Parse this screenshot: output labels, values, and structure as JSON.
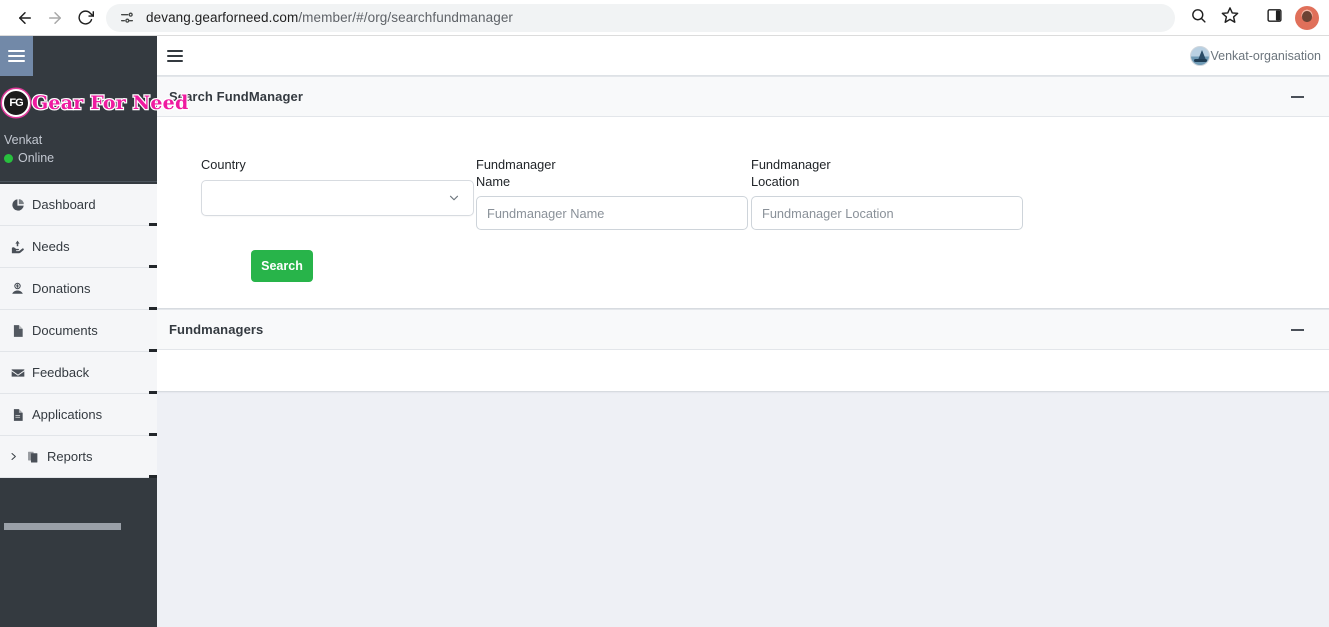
{
  "browser": {
    "back_icon": "back-arrow-icon",
    "forward_icon": "forward-arrow-icon",
    "reload_icon": "reload-icon",
    "site_info_icon": "site-settings-icon",
    "url_main": "devang.gearforneed.com",
    "url_path": "/member/#/org/searchfundmanager",
    "zoom_icon": "zoom-search-icon",
    "bookmark_icon": "star-bookmark-icon",
    "sidepanel_icon": "side-panel-icon",
    "profile_icon": "profile-avatar-icon"
  },
  "sidebar": {
    "toggle_icon": "hamburger-toggle-icon",
    "logo_badge": "FG",
    "logo_text": "Gear For Need",
    "user": {
      "name": "Venkat",
      "status": "Online",
      "status_color": "#28c03e"
    },
    "items": [
      {
        "label": "Dashboard",
        "icon": "pie-chart-icon",
        "has_chevron": false
      },
      {
        "label": "Needs",
        "icon": "hands-help-icon",
        "has_chevron": false
      },
      {
        "label": "Donations",
        "icon": "donate-icon",
        "has_chevron": false
      },
      {
        "label": "Documents",
        "icon": "file-icon",
        "has_chevron": false
      },
      {
        "label": "Feedback",
        "icon": "envelope-icon",
        "has_chevron": false
      },
      {
        "label": "Applications",
        "icon": "document-icon",
        "has_chevron": false
      },
      {
        "label": "Reports",
        "icon": "copy-files-icon",
        "has_chevron": true
      }
    ]
  },
  "topnav": {
    "burger_icon": "hamburger-menu-icon",
    "org_avatar_icon": "organisation-avatar-icon",
    "org_name": "Venkat-organisation"
  },
  "search_panel": {
    "title": "Search FundManager",
    "collapse_icon": "minus-collapse-icon",
    "fields": {
      "country_label": "Country",
      "country_value": "",
      "country_chevron_icon": "chevron-down-icon",
      "name_label": "Fundmanager Name",
      "name_value": "",
      "name_placeholder": "Fundmanager Name",
      "location_label": "Fundmanager Location",
      "location_value": "",
      "location_placeholder": "Fundmanager Location"
    },
    "search_button": "Search",
    "search_button_color": "#28b44a"
  },
  "results_panel": {
    "title": "Fundmanagers",
    "collapse_icon": "minus-collapse-icon",
    "rows": []
  }
}
